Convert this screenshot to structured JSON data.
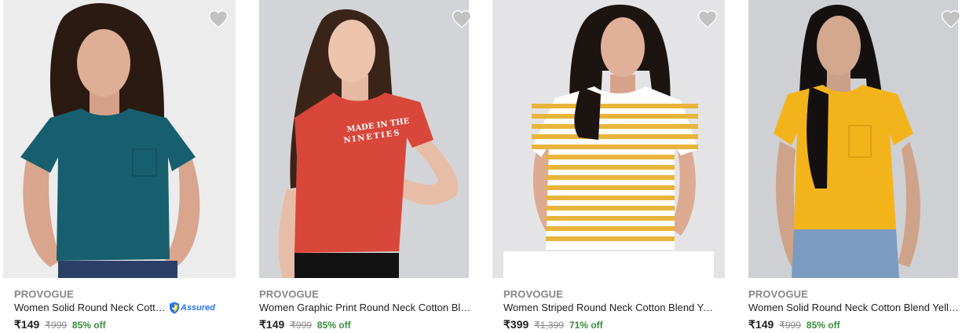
{
  "products": [
    {
      "brand": "PROVOGUE",
      "title": "Women Solid Round Neck Cotto...",
      "assured_label": "Assured",
      "price": "₹149",
      "mrp": "₹999",
      "discount": "85% off",
      "image_subject": "woman-teal-tshirt",
      "bg_color": "#ececed",
      "shirt_color": "#175f6f",
      "hair_color": "#2a1a12"
    },
    {
      "brand": "PROVOGUE",
      "title": "Women Graphic Print Round Neck Cotton Ble...",
      "price": "₹149",
      "mrp": "₹999",
      "discount": "85% off",
      "image_subject": "woman-red-graphic-tshirt",
      "print_text": "MADE IN THE NINETIES",
      "bg_color": "#d3d4d8",
      "shirt_color": "#d8473a",
      "hair_color": "#3a2418"
    },
    {
      "brand": "PROVOGUE",
      "title": "Women Striped Round Neck Cotton Blend Yel...",
      "price": "₹399",
      "mrp": "₹1,399",
      "discount": "71% off",
      "image_subject": "woman-yellow-striped-tshirt",
      "bg_color": "#e4e4e6",
      "shirt_color": "#e8b43a",
      "hair_color": "#1c1410"
    },
    {
      "brand": "PROVOGUE",
      "title": "Women Solid Round Neck Cotton Blend Yello...",
      "price": "₹149",
      "mrp": "₹999",
      "discount": "85% off",
      "image_subject": "woman-yellow-tshirt",
      "bg_color": "#cfd0d3",
      "shirt_color": "#f3b41b",
      "hair_color": "#151010"
    }
  ],
  "icons": {
    "wishlist": "heart-icon",
    "assured": "shield-icon"
  },
  "colors": {
    "wishlist_heart": "#c2c2c2",
    "discount": "#388e3c",
    "assured": "#2874f0",
    "brand": "#878787"
  }
}
